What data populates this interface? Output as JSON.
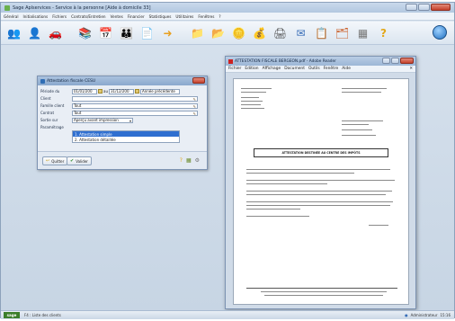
{
  "app": {
    "title": "Sage Aplservices - Service à la personne [Aide à domicile 33]",
    "menu": [
      "Général",
      "Initialisations",
      "Fichiers",
      "Contrats/Entretien",
      "Ventes",
      "Financier",
      "Statistiques",
      "Utilitaires",
      "Fenêtres",
      "?"
    ]
  },
  "toolbar": {
    "icons": [
      "people-icon",
      "person-icon",
      "car-icon",
      "books-icon",
      "calendar-icon",
      "team-icon",
      "document-icon",
      "arrow-icon",
      "folder-icon",
      "folder-user-icon",
      "coins-icon",
      "money-bag-icon",
      "printer-icon",
      "mail-icon",
      "notes-icon",
      "card-icon",
      "grid-icon",
      "help-icon"
    ]
  },
  "dialog": {
    "title": "Attestation fiscale CESU",
    "fields": [
      {
        "label": "Période du",
        "value": "01/01/200",
        "to_label": "au",
        "to_value": "31/12/200",
        "option": "Année précédente"
      },
      {
        "label": "Client",
        "value": ""
      },
      {
        "label": "Famille client",
        "value": "Tout"
      },
      {
        "label": "Contrat",
        "value": "Tout"
      },
      {
        "label": "Sortie sur",
        "value": "Aperçu avant impression"
      },
      {
        "label": "Paramétrage",
        "value": ""
      }
    ],
    "list_items": [
      "1. Attestation simple",
      "2. Attestation détaillée"
    ],
    "buttons": {
      "quit": "Quitter",
      "validate": "Valider"
    }
  },
  "pdf": {
    "title": "ATTESTATION FISCALE BERGEON.pdf - Adobe Reader",
    "menu": [
      "Fichier",
      "Edition",
      "Affichage",
      "Document",
      "Outils",
      "Fenêtre",
      "Aide"
    ],
    "page_heading": "ATTESTATION DESTINÉE AU CENTRE DES IMPÔTS"
  },
  "status": {
    "left_text": "F4 : Liste des clients",
    "right_user": "Administrateur",
    "right_time": "15:16"
  }
}
